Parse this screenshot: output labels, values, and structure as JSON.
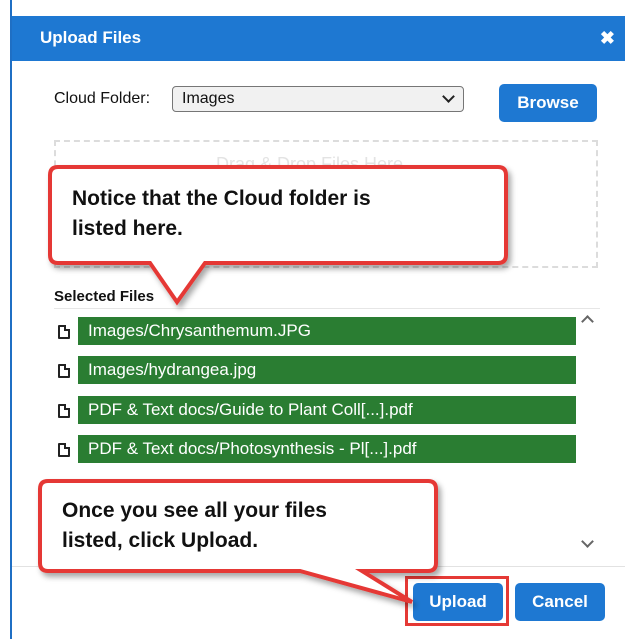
{
  "dialog": {
    "title": "Upload Files",
    "close_icon": "close-icon"
  },
  "folder": {
    "label": "Cloud Folder:",
    "selected": "Images",
    "browse_label": "Browse"
  },
  "dropzone": {
    "text": "Drag & Drop Files Here"
  },
  "selected_files": {
    "label": "Selected Files",
    "items": [
      "Images/Chrysanthemum.JPG",
      "Images/hydrangea.jpg",
      "PDF & Text docs/Guide to Plant Coll[...].pdf",
      "PDF & Text docs/Photosynthesis - Pl[...].pdf"
    ]
  },
  "actions": {
    "upload_label": "Upload",
    "cancel_label": "Cancel"
  },
  "callouts": {
    "top_line1": "Notice that the Cloud folder is",
    "top_line2": "listed here.",
    "bottom_line1": "Once you see all your files",
    "bottom_line2": "listed, click Upload."
  },
  "colors": {
    "primary": "#1e78d2",
    "file_row": "#2a7d32",
    "callout_border": "#e53935"
  }
}
